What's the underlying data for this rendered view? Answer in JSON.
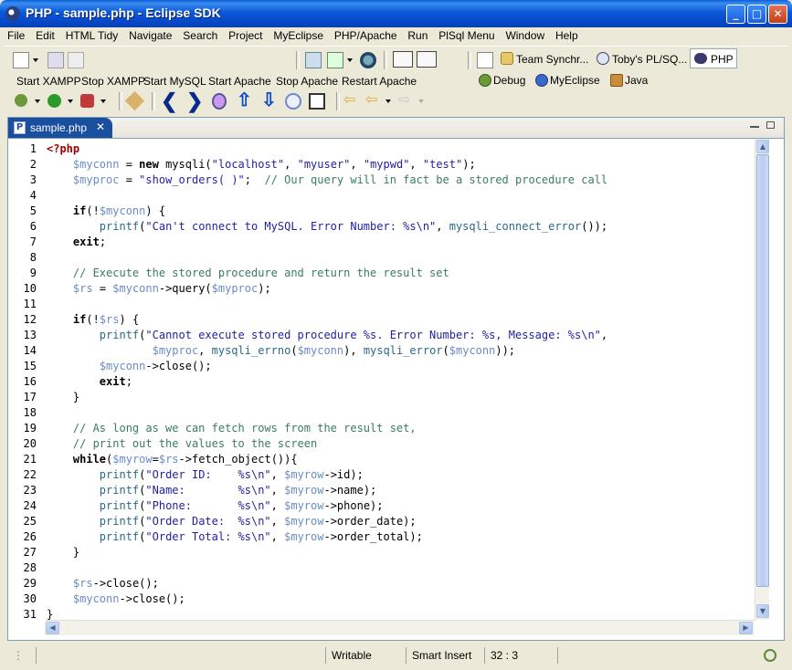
{
  "window": {
    "title": "PHP - sample.php - Eclipse SDK",
    "min_glyph": "_",
    "max_glyph": "□",
    "close_glyph": "✕"
  },
  "menu": [
    "File",
    "Edit",
    "HTML Tidy",
    "Navigate",
    "Search",
    "Project",
    "MyEclipse",
    "PHP/Apache",
    "Run",
    "PlSql Menu",
    "Window",
    "Help"
  ],
  "toolbar": {
    "server_buttons": [
      "Start XAMPP",
      "Stop XAMPP",
      "Start MySQL",
      "Start Apache",
      "Stop Apache",
      "Restart Apache"
    ],
    "perspectives": [
      "Team Synchr...",
      "Toby's PL/SQ...",
      "PHP",
      "Debug",
      "MyEclipse",
      "Java"
    ]
  },
  "editor": {
    "tab_label": "sample.php",
    "line_numbers": [
      "1",
      "2",
      "3",
      "4",
      "5",
      "6",
      "7",
      "8",
      "9",
      "10",
      "11",
      "12",
      "13",
      "14",
      "15",
      "16",
      "17",
      "18",
      "19",
      "20",
      "21",
      "22",
      "23",
      "24",
      "25",
      "26",
      "27",
      "28",
      "29",
      "30",
      "31"
    ]
  },
  "status": {
    "write_mode": "Writable",
    "insert_mode": "Smart Insert",
    "cursor_position": "32 : 3"
  }
}
